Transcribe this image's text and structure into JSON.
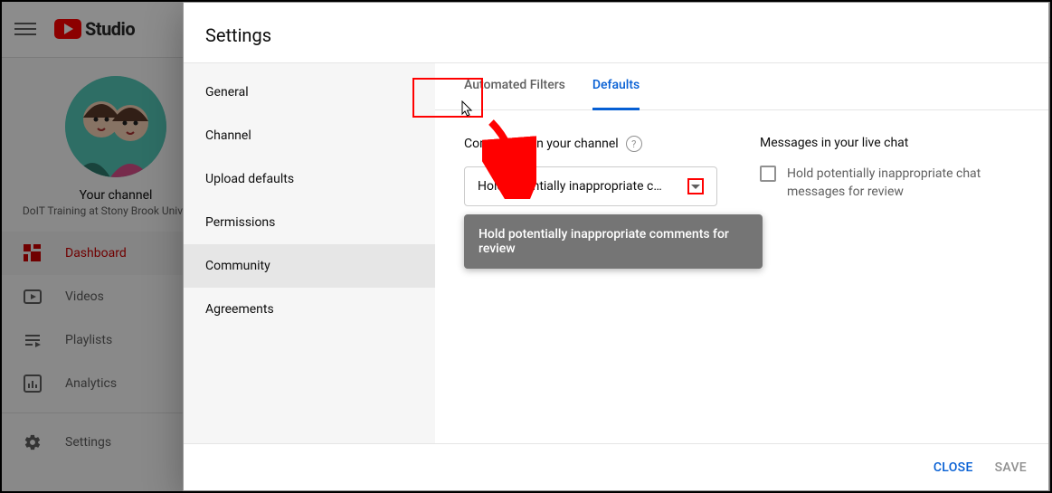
{
  "topbar": {
    "logo_text": "Studio"
  },
  "channel": {
    "label": "Your channel",
    "name": "DoIT Training at Stony Brook University"
  },
  "sidenav": {
    "items": [
      {
        "label": "Dashboard"
      },
      {
        "label": "Videos"
      },
      {
        "label": "Playlists"
      },
      {
        "label": "Analytics"
      }
    ],
    "settings_label": "Settings"
  },
  "dialog": {
    "title": "Settings",
    "nav": [
      {
        "label": "General"
      },
      {
        "label": "Channel"
      },
      {
        "label": "Upload defaults"
      },
      {
        "label": "Permissions"
      },
      {
        "label": "Community"
      },
      {
        "label": "Agreements"
      }
    ],
    "inner_tabs": {
      "automated": "Automated Filters",
      "defaults": "Defaults"
    },
    "comments": {
      "title": "Comments on your channel",
      "selected": "Hold potentially inappropriate c…",
      "menu_item": "Hold potentially inappropriate comments for review"
    },
    "chat": {
      "title": "Messages in your live chat",
      "checkbox_label": "Hold potentially inappropriate chat messages for review"
    },
    "footer": {
      "close": "CLOSE",
      "save": "SAVE"
    }
  }
}
